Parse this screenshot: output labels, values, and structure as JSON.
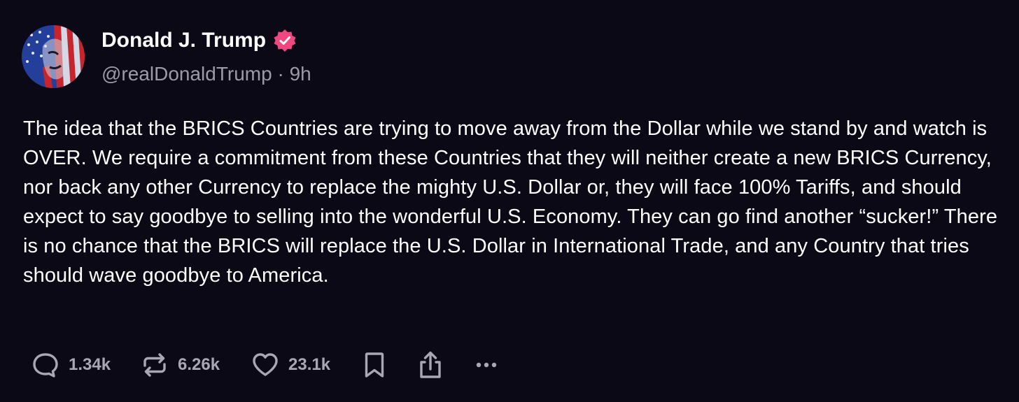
{
  "author": {
    "display_name": "Donald J. Trump",
    "handle": "@realDonaldTrump",
    "separator": "·",
    "time_ago": "9h",
    "verified_color": "#f0477f"
  },
  "post": {
    "text": "The idea that the BRICS Countries are trying to move away from the Dollar while we stand by and watch is OVER. We require a commitment from these Countries that they will neither create a new BRICS Currency, nor back any other Currency to replace the mighty U.S. Dollar or, they will face 100% Tariffs, and should expect to say goodbye to selling into the wonderful U.S. Economy. They can go find another “sucker!” There is no chance that the BRICS will replace the U.S. Dollar in International Trade, and any Country that tries should wave goodbye to America."
  },
  "actions": {
    "replies": "1.34k",
    "reposts": "6.26k",
    "likes": "23.1k",
    "icons": [
      "reply-icon",
      "repost-icon",
      "like-icon",
      "bookmark-icon",
      "share-icon",
      "more-icon"
    ]
  },
  "colors": {
    "background": "#0b0915",
    "text": "#ffffff",
    "muted": "#9c9aa6"
  }
}
